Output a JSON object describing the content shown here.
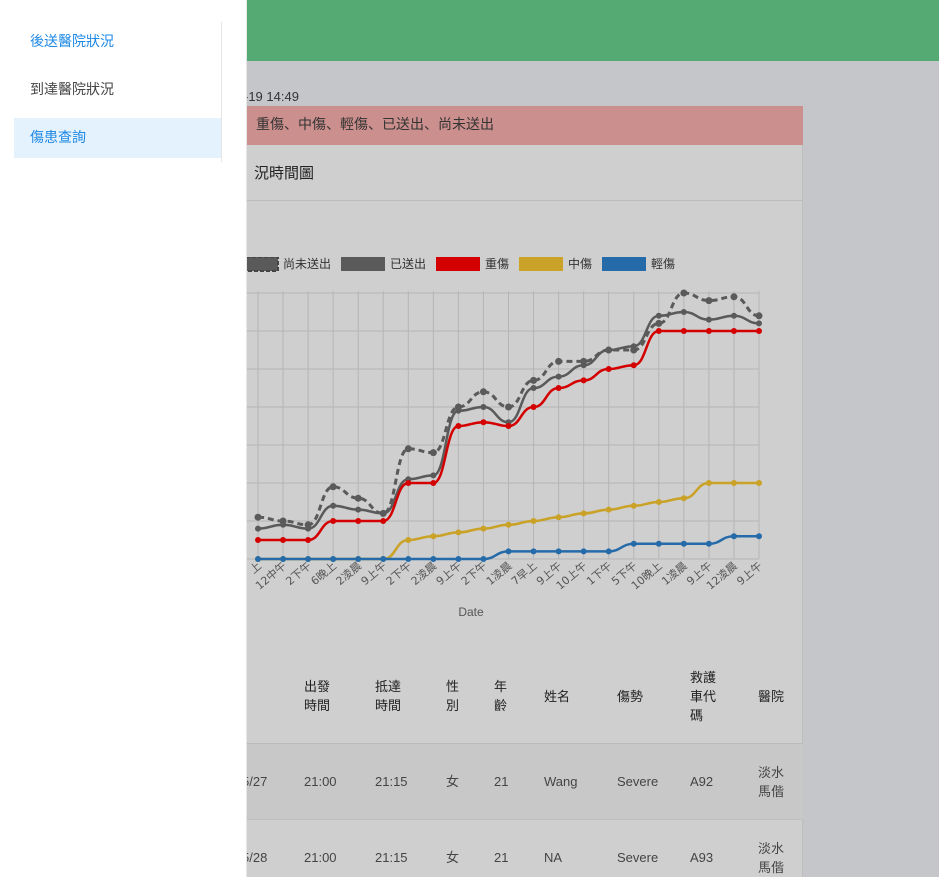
{
  "header": {
    "timestamp": "-19 14:49",
    "alert_text": "重傷、中傷、輕傷、已送出、尚未送出",
    "panel_title": "況時間圖"
  },
  "sidebar": {
    "items": [
      {
        "label": "後送醫院狀況"
      },
      {
        "label": "到達醫院狀況"
      },
      {
        "label": "傷患查詢"
      }
    ]
  },
  "colors": {
    "topbar": "#54aa72",
    "alert_bg": "#cb8f8d",
    "accent": "#1e88e5"
  },
  "chart_data": {
    "type": "line",
    "xlabel": "Date",
    "ylabel": "",
    "grid": true,
    "legend_placement": "top",
    "categories": [
      "上",
      "12中午",
      "2下午",
      "6晚上",
      "2凌晨",
      "9上午",
      "2下午",
      "2凌晨",
      "9上午",
      "2下午",
      "1凌晨",
      "7早上",
      "9上午",
      "10上午",
      "1下午",
      "5下午",
      "10晚上",
      "1凌晨",
      "9上午",
      "12凌晨",
      "9上午"
    ],
    "series": [
      {
        "name": "尚未送出",
        "color": "#5a5a5a",
        "dash": true,
        "values": [
          11,
          10,
          9,
          19,
          16,
          12,
          29,
          28,
          40,
          44,
          40,
          47,
          52,
          52,
          55,
          55,
          62,
          70,
          68,
          69,
          64
        ]
      },
      {
        "name": "已送出",
        "color": "#5a5a5a",
        "dash": false,
        "values": [
          8,
          9,
          8,
          14,
          13,
          12,
          21,
          22,
          39,
          40,
          36,
          45,
          48,
          51,
          55,
          56,
          64,
          65,
          63,
          64,
          62
        ]
      },
      {
        "name": "重傷",
        "color": "#d40000",
        "dash": false,
        "values": [
          5,
          5,
          5,
          10,
          10,
          10,
          20,
          20,
          35,
          36,
          35,
          40,
          45,
          47,
          50,
          51,
          60,
          60,
          60,
          60,
          60
        ]
      },
      {
        "name": "中傷",
        "color": "#c9a227",
        "dash": false,
        "values": [
          0,
          0,
          0,
          0,
          0,
          0,
          5,
          6,
          7,
          8,
          9,
          10,
          11,
          12,
          13,
          14,
          15,
          16,
          20,
          20,
          20
        ]
      },
      {
        "name": "輕傷",
        "color": "#256ba9",
        "dash": false,
        "values": [
          0,
          0,
          0,
          0,
          0,
          0,
          0,
          0,
          0,
          0,
          2,
          2,
          2,
          2,
          2,
          4,
          4,
          4,
          4,
          6,
          6
        ]
      }
    ]
  },
  "table": {
    "headers": [
      "出發\n時間",
      "抵達\n時間",
      "性\n別",
      "年\n齡",
      "姓名",
      "傷勢",
      "救護\n車代\n碼",
      "醫院"
    ],
    "rows": [
      {
        "date": "5/27",
        "depart": "21:00",
        "arrive": "21:15",
        "sex": "女",
        "age": "21",
        "name": "Wang",
        "severity": "Severe",
        "ambulance": "A92",
        "hospital": "淡水\n馬偕"
      },
      {
        "date": "5/28",
        "depart": "21:00",
        "arrive": "21:15",
        "sex": "女",
        "age": "21",
        "name": "NA",
        "severity": "Severe",
        "ambulance": "A93",
        "hospital": "淡水\n馬偕"
      }
    ]
  }
}
